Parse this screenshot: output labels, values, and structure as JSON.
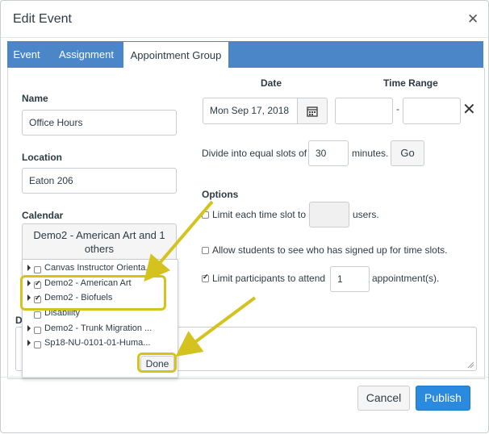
{
  "dialog": {
    "title": "Edit Event"
  },
  "tabs": [
    {
      "label": "Event",
      "active": false
    },
    {
      "label": "Assignment",
      "active": false
    },
    {
      "label": "Appointment Group",
      "active": true
    }
  ],
  "form": {
    "name_label": "Name",
    "name_value": "Office Hours",
    "location_label": "Location",
    "location_value": "Eaton 206",
    "calendar_label": "Calendar",
    "calendar_button": "Demo2 - American Art and 1 others",
    "details_label_partial": "D"
  },
  "calendar_list": {
    "items": [
      {
        "label": "Canvas Instructor Orienta...",
        "checked": false
      },
      {
        "label": "Demo2 - American Art",
        "checked": true
      },
      {
        "label": "Demo2 - Biofuels",
        "checked": true
      },
      {
        "label": "Disability",
        "checked": false
      },
      {
        "label": "Demo2 - Trunk Migration ...",
        "checked": false
      },
      {
        "label": "Sp18-NU-0101-01-Huma...",
        "checked": false
      }
    ],
    "done_label": "Done"
  },
  "schedule": {
    "date_header": "Date",
    "time_range_header": "Time Range",
    "date_value": "Mon Sep 17, 2018",
    "time_start": "",
    "time_end": "",
    "dash": "-",
    "divide_prefix": "Divide into equal slots of",
    "slot_minutes": "30",
    "divide_suffix": "minutes.",
    "go_label": "Go"
  },
  "options": {
    "header": "Options",
    "limit_slot_prefix": "Limit each time slot to",
    "limit_slot_value": "",
    "limit_slot_suffix": "users.",
    "limit_slot_checked": false,
    "allow_see_label": "Allow students to see who has signed up for time slots.",
    "allow_see_checked": false,
    "limit_participants_prefix": "Limit participants to attend",
    "limit_participants_value": "1",
    "limit_participants_suffix": "appointment(s).",
    "limit_participants_checked": true
  },
  "footer": {
    "cancel_label": "Cancel",
    "publish_label": "Publish"
  },
  "colors": {
    "tab_bar": "#4a86c8",
    "publish": "#2a8ae0",
    "highlight": "#d4c21f"
  }
}
